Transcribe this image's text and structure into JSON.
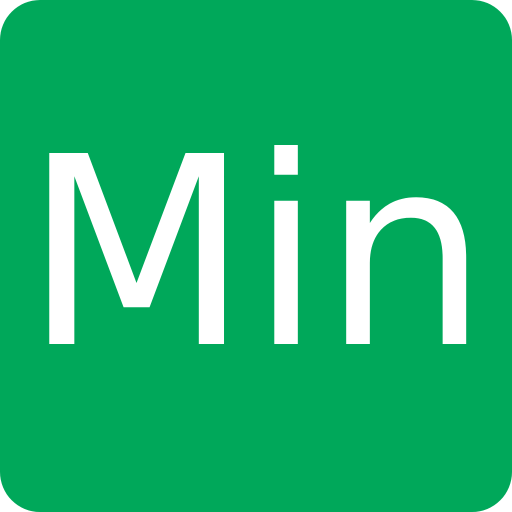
{
  "app_icon": {
    "label": "Min",
    "background_color": "#00a85a",
    "text_color": "#ffffff"
  }
}
